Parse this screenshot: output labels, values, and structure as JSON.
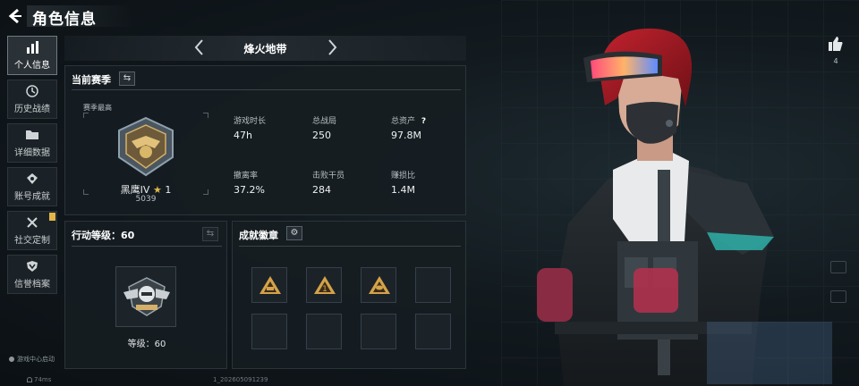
{
  "header": {
    "title": "角色信息"
  },
  "sidebar": {
    "items": [
      {
        "label": "个人信息",
        "icon": "bar-chart-icon",
        "active": true
      },
      {
        "label": "历史战绩",
        "icon": "clock-icon"
      },
      {
        "label": "详细数据",
        "icon": "folder-icon"
      },
      {
        "label": "账号成就",
        "icon": "medal-icon"
      },
      {
        "label": "社交定制",
        "icon": "tools-icon",
        "badge": true
      },
      {
        "label": "信誉档案",
        "icon": "shield-icon"
      }
    ],
    "game_center": "游戏中心启动"
  },
  "footer": {
    "latency": "74ms",
    "build": "1_202605091239"
  },
  "mode": {
    "name": "烽火地带"
  },
  "season": {
    "title": "当前赛季",
    "best_label": "赛季最高",
    "rank_name": "黑鹰IV",
    "rank_stars": "1",
    "score": "5039",
    "stats": [
      {
        "label": "游戏时长",
        "value": "47h"
      },
      {
        "label": "总战局",
        "value": "250"
      },
      {
        "label": "总资产",
        "value": "97.8M",
        "help": "?"
      },
      {
        "label": "撤离率",
        "value": "37.2%"
      },
      {
        "label": "击败干员",
        "value": "284"
      },
      {
        "label": "赚损比",
        "value": "1.4M"
      }
    ]
  },
  "action_level": {
    "title": "行动等级：60",
    "level_label": "等级：60"
  },
  "achievements": {
    "title": "成就徽章",
    "slots": 8,
    "filled": 3
  },
  "likes": {
    "count": "4"
  },
  "colors": {
    "accent": "#e3b64a",
    "hair": "#b5202a",
    "panel": "#161d22"
  }
}
